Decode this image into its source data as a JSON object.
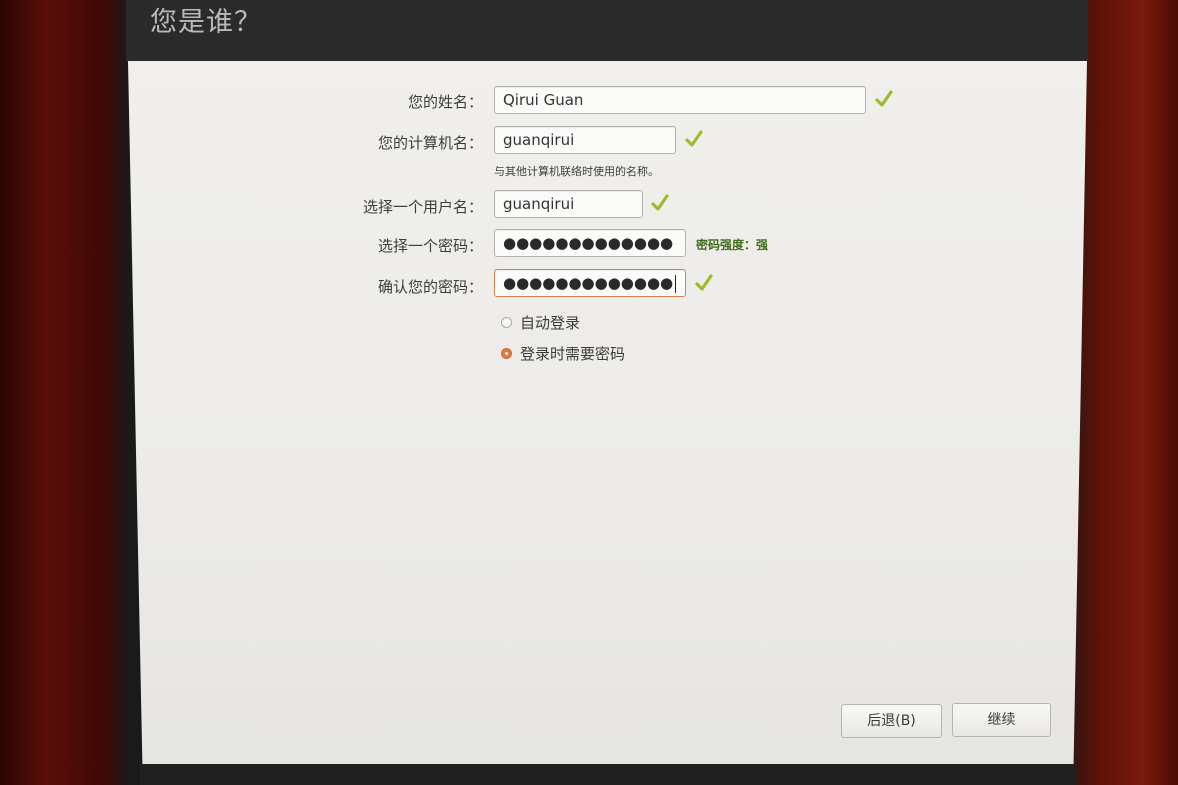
{
  "window": {
    "title": "您是谁？"
  },
  "form": {
    "name_label": "您的姓名：",
    "name_value": "Qirui Guan",
    "computer_label": "您的计算机名：",
    "computer_value": "guanqirui",
    "computer_hint": "与其他计算机联络时使用的名称。",
    "username_label": "选择一个用户名：",
    "username_value": "guanqirui",
    "password_label": "选择一个密码：",
    "password_value": "●●●●●●●●●●●●●",
    "password_strength": "密码强度：强",
    "confirm_label": "确认您的密码：",
    "confirm_value": "●●●●●●●●●●●●●"
  },
  "login_options": {
    "auto_login": "自动登录",
    "require_password": "登录时需要密码",
    "selected": "require_password"
  },
  "buttons": {
    "back": "后退(B)",
    "continue": "继续"
  },
  "colors": {
    "check": "#9bbd2c",
    "strength": "#3d6f1e",
    "accent": "#e07a45"
  },
  "icons": {
    "valid": "check-icon"
  }
}
